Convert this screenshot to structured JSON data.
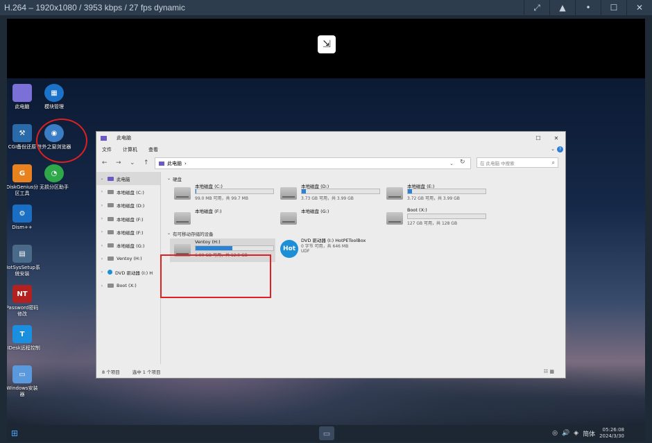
{
  "viewer": {
    "title": "H.264 – 1920x1080 / 3953 kbps / 27 fps dynamic",
    "controls": [
      "⤢",
      "▲",
      "•",
      "☐",
      "✕"
    ]
  },
  "desktop": {
    "icons": [
      {
        "label": "此电脑",
        "glyph": "",
        "color": "#7b6fd8"
      },
      {
        "label": "模块管理",
        "glyph": "▦",
        "color": "#1a73c8"
      },
      {
        "label": "CGI备份还原",
        "glyph": "⚒",
        "color": "#2a6aa8"
      },
      {
        "label": "世外之窗浏览器",
        "glyph": "◉",
        "color": "#3b7dc4"
      },
      {
        "label": "DiskGenius分区工具",
        "glyph": "G",
        "color": "#e8821e"
      },
      {
        "label": "无损分区助手",
        "glyph": "◔",
        "color": "#2fa84a"
      },
      {
        "label": "Dism++",
        "glyph": "⚙",
        "color": "#1a6fc4"
      },
      {
        "label": "HotSysSetup系统安装",
        "glyph": "▤",
        "color": "#4a6a8a"
      },
      {
        "label": "Password密码修改",
        "glyph": "NT",
        "color": "#b22020"
      },
      {
        "label": "EIDesk远程控制",
        "glyph": "T",
        "color": "#1a8fe0"
      },
      {
        "label": "Windows安装器",
        "glyph": "▭",
        "color": "#5a9adc"
      }
    ]
  },
  "taskbar": {
    "time": "05:26:08",
    "date": "2024/3/30",
    "lang": "简体"
  },
  "explorer": {
    "title": "此电脑",
    "menu": [
      "文件",
      "计算机",
      "查看"
    ],
    "address": "此电脑",
    "search_placeholder": "在 此电脑 中搜索",
    "nav": [
      {
        "label": "此电脑",
        "root": true
      },
      {
        "label": "本地磁盘 (C:)"
      },
      {
        "label": "本地磁盘 (D:)"
      },
      {
        "label": "本地磁盘 (F:)"
      },
      {
        "label": "本地磁盘 (F:)"
      },
      {
        "label": "本地磁盘 (G:)"
      },
      {
        "label": "Ventoy (H:)"
      },
      {
        "label": "DVD 驱动器 (I:) H"
      },
      {
        "label": "Boot (X:)"
      }
    ],
    "group_hdd": "硬盘",
    "group_removable": "有可移动存储的设备",
    "drives": [
      {
        "name": "本地磁盘 (C:)",
        "size": "99.0 MB 可用，共 99.7 MB",
        "fill": 0.01
      },
      {
        "name": "本地磁盘 (D:)",
        "size": "3.73 GB 可用，共 3.99 GB",
        "fill": 0.05
      },
      {
        "name": "本地磁盘 (E:)",
        "size": "3.72 GB 可用，共 3.99 GB",
        "fill": 0.05
      },
      {
        "name": "本地磁盘 (F:)",
        "size": "",
        "fill": null
      },
      {
        "name": "本地磁盘 (G:)",
        "size": "",
        "fill": null
      },
      {
        "name": "Boot (X:)",
        "size": "127 GB 可用，共 128 GB",
        "fill": 0.0
      }
    ],
    "ventoy": {
      "name": "Ventoy (H:)",
      "size": "6.90 GB 可用，共 12.9 GB",
      "fill": 0.47
    },
    "dvd": {
      "icon_text": "Hot",
      "name": "DVD 驱动器 (I:) HotPEToolBox",
      "size": "0 字节 可用，共 646 MB",
      "fs": "UDF"
    },
    "status_count": "8 个项目",
    "status_selected": "选中 1 个项目"
  }
}
